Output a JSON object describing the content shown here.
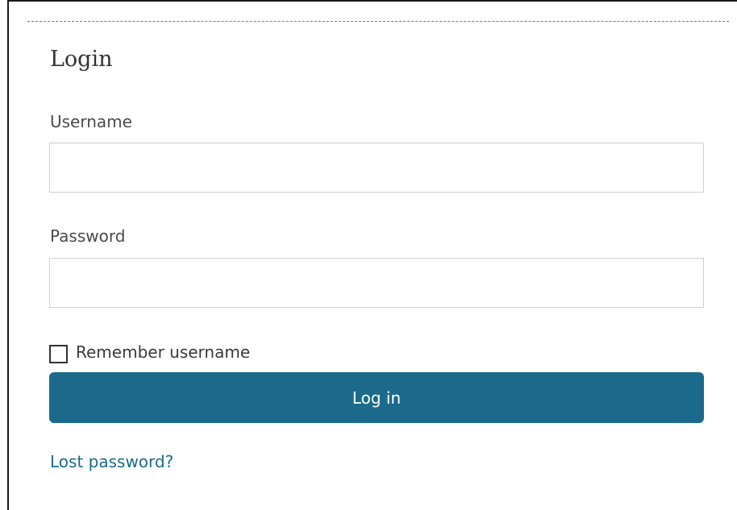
{
  "login": {
    "title": "Login",
    "username_label": "Username",
    "username_value": "",
    "password_label": "Password",
    "password_value": "",
    "remember_label": "Remember username",
    "remember_checked": false,
    "submit_label": "Log in",
    "lost_password_link": "Lost password?"
  },
  "colors": {
    "primary": "#1b6a8c",
    "input_border": "#cfcfcf",
    "text": "#333333"
  }
}
